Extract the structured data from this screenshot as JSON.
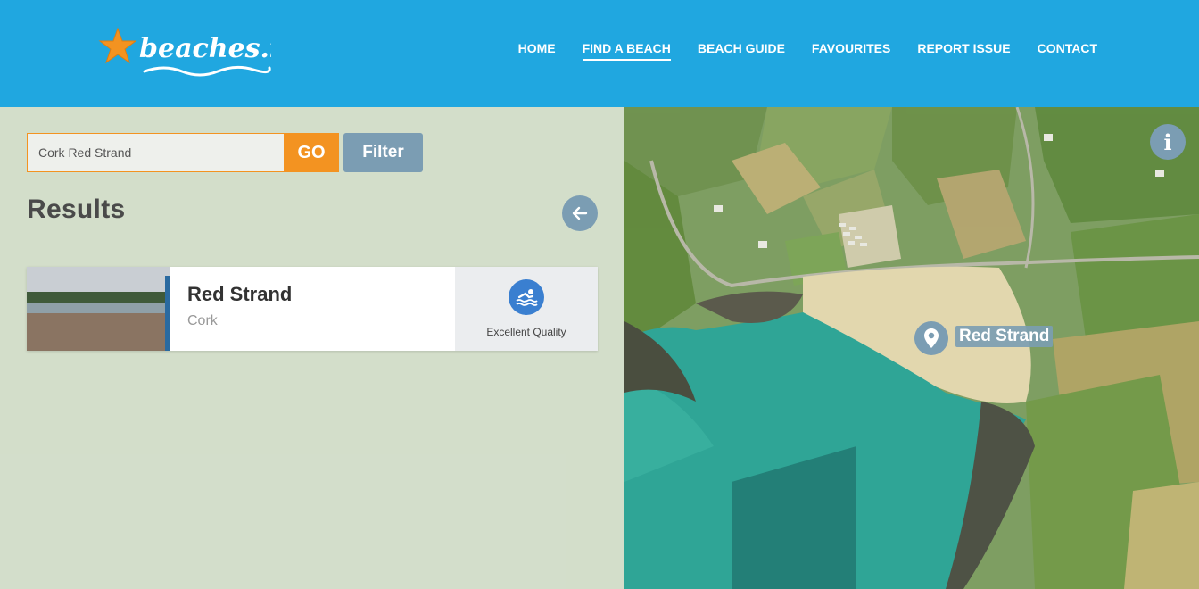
{
  "brand": {
    "name": "beaches.ie"
  },
  "nav": [
    {
      "label": "HOME",
      "active": false
    },
    {
      "label": "FIND A BEACH",
      "active": true
    },
    {
      "label": "BEACH GUIDE",
      "active": false
    },
    {
      "label": "FAVOURITES",
      "active": false
    },
    {
      "label": "REPORT ISSUE",
      "active": false
    },
    {
      "label": "CONTACT",
      "active": false
    }
  ],
  "search": {
    "value": "Cork Red Strand",
    "go_label": "GO",
    "filter_label": "Filter"
  },
  "results": {
    "title": "Results",
    "items": [
      {
        "name": "Red Strand",
        "county": "Cork",
        "quality": "Excellent Quality",
        "quality_icon": "swimmer-icon"
      }
    ]
  },
  "map": {
    "marker_label": "Red Strand",
    "info_icon": "info-icon"
  },
  "colors": {
    "header": "#20a7e0",
    "accent": "#f39321",
    "muted_button": "#7b9db3",
    "quality_badge": "#3a7fd0"
  }
}
